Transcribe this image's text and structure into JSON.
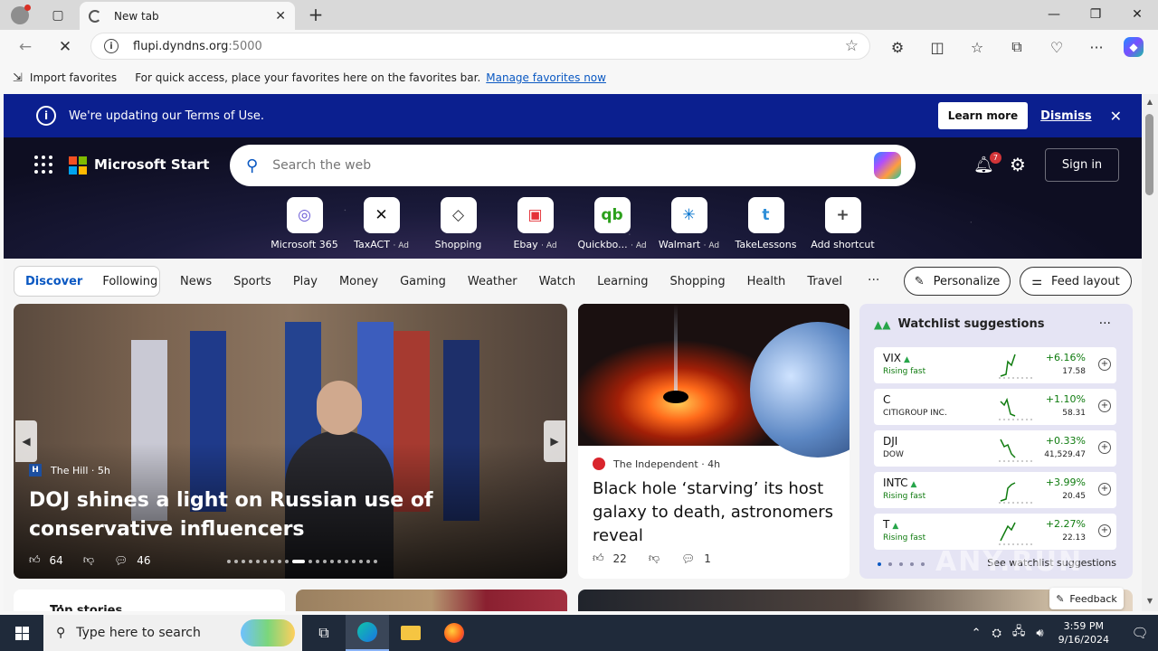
{
  "browser": {
    "tab_title": "New tab",
    "url_host": "flupi.dyndns.org",
    "url_port": ":5000",
    "favbar": {
      "import_label": "Import favorites",
      "message": "For quick access, place your favorites here on the favorites bar.",
      "manage_link": "Manage favorites now"
    }
  },
  "banner": {
    "text": "We're updating our Terms of Use.",
    "learn_more": "Learn more",
    "dismiss": "Dismiss"
  },
  "header": {
    "brand": "Microsoft Start",
    "search_placeholder": "Search the web",
    "notification_count": "7",
    "sign_in": "Sign in"
  },
  "shortcuts": [
    {
      "label": "Microsoft 365",
      "ad": "",
      "icon": "ms365-icon",
      "glyph": "◎",
      "color": "#6b5bd6"
    },
    {
      "label": "TaxACT",
      "ad": "· Ad",
      "icon": "taxact-icon",
      "glyph": "✕",
      "color": "#111111"
    },
    {
      "label": "Shopping",
      "ad": "",
      "icon": "tag-icon",
      "glyph": "◇",
      "color": "#333333"
    },
    {
      "label": "Ebay",
      "ad": "· Ad",
      "icon": "ebay-icon",
      "glyph": "▣",
      "color": "#e53238"
    },
    {
      "label": "Quickbo...",
      "ad": "· Ad",
      "icon": "quickbooks-icon",
      "glyph": "qb",
      "color": "#2ca01c"
    },
    {
      "label": "Walmart",
      "ad": "· Ad",
      "icon": "walmart-icon",
      "glyph": "✳",
      "color": "#0071ce"
    },
    {
      "label": "TakeLessons",
      "ad": "",
      "icon": "takelessons-icon",
      "glyph": "t",
      "color": "#2f8fd8"
    },
    {
      "label": "Add shortcut",
      "ad": "",
      "icon": "plus-icon",
      "glyph": "+",
      "color": "#444444"
    }
  ],
  "nav": {
    "discover": "Discover",
    "following": "Following",
    "links": [
      "News",
      "Sports",
      "Play",
      "Money",
      "Gaming",
      "Weather",
      "Watch",
      "Learning",
      "Shopping",
      "Health",
      "Travel"
    ],
    "more": "···",
    "personalize": "Personalize",
    "feed_layout": "Feed layout"
  },
  "main_story": {
    "source": "The Hill",
    "age": "· 5h",
    "title": "DOJ shines a light on Russian use of conservative influencers",
    "likes": "64",
    "comments": "46"
  },
  "story2": {
    "source": "The Independent",
    "age": "· 4h",
    "title": "Black hole ‘starving’ its host galaxy to death, astronomers reveal",
    "likes": "22",
    "comments": "1"
  },
  "watchlist": {
    "title": "Watchlist suggestions",
    "see_more": "See watchlist suggestions",
    "items": [
      {
        "symbol": "VIX",
        "sub": "Rising fast",
        "rising": true,
        "change": "+6.16%",
        "price": "17.58"
      },
      {
        "symbol": "C",
        "sub": "CITIGROUP INC.",
        "rising": false,
        "change": "+1.10%",
        "price": "58.31"
      },
      {
        "symbol": "DJI",
        "sub": "DOW",
        "rising": false,
        "change": "+0.33%",
        "price": "41,529.47"
      },
      {
        "symbol": "INTC",
        "sub": "Rising fast",
        "rising": true,
        "change": "+3.99%",
        "price": "20.45"
      },
      {
        "symbol": "T",
        "sub": "Rising fast",
        "rising": true,
        "change": "+2.27%",
        "price": "22.13"
      }
    ]
  },
  "lower": {
    "top_stories": "Top stories",
    "feedback": "Feedback"
  },
  "taskbar": {
    "search_placeholder": "Type here to search",
    "time": "3:59 PM",
    "date": "9/16/2024"
  },
  "watermark": "ANY.RUN",
  "colors": {
    "banner_bg": "#0b1f8f",
    "accent_blue": "#0a58c2",
    "gain_green": "#107c10",
    "watchlist_bg": "#e5e4f4"
  }
}
